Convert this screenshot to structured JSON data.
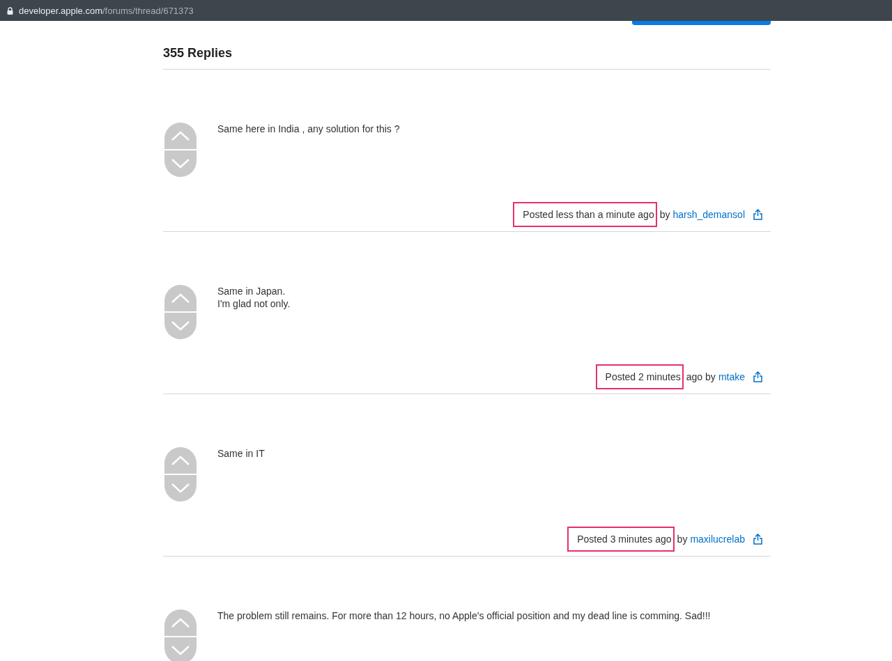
{
  "address_bar": {
    "domain": "developer.apple.com",
    "path": "/forums/thread/671373"
  },
  "replies_heading": "355 Replies",
  "replies": [
    {
      "lines": [
        "Same here in India , any solution for this ?"
      ],
      "posted_marked": "Posted less than a minute ago",
      "by": "by",
      "author": "harsh_demansol"
    },
    {
      "lines": [
        "Same in Japan.",
        "I'm glad not only."
      ],
      "posted_marked": "Posted 2 minutes",
      "posted_rest": "ago",
      "by": "by",
      "author": "mtake"
    },
    {
      "lines": [
        "Same in IT"
      ],
      "posted_marked": "Posted 3 minutes ago",
      "by": "by",
      "author": "maxilucrelab"
    },
    {
      "lines": [
        "The problem still remains. For more than 12 hours, no Apple's official position and my dead line is comming. Sad!!!"
      ]
    }
  ]
}
